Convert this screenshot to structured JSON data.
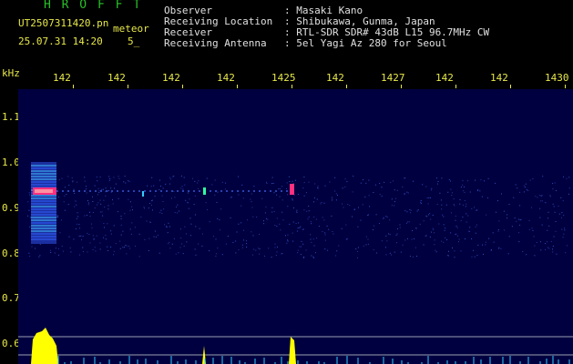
{
  "header": {
    "logo": "H R O F F T",
    "filename": "UT2507311420.pn",
    "type_label": "meteor",
    "datetime": "25.07.31 14:20",
    "count": "5_"
  },
  "info": {
    "observer_label": "Observer",
    "observer_value": ": Masaki Kano",
    "location_label": "Receiving Location",
    "location_value": ": Shibukawa, Gunma, Japan",
    "receiver_label": "Receiver",
    "receiver_value": ": RTL-SDR SDR# 43dB L15 96.7MHz CW",
    "antenna_label": "Receiving Antenna",
    "antenna_value": ": 5el Yagi Az 280 for Seoul"
  },
  "axis": {
    "y_unit": "kHz",
    "y_ticks": [
      "1.1",
      "1.0",
      "0.9",
      "0.8",
      "0.7",
      "0.6"
    ],
    "x_ticks": [
      "142",
      "142",
      "142",
      "142",
      "1425",
      "142",
      "1427",
      "142",
      "142",
      "1430"
    ]
  },
  "colors": {
    "background": "#000000",
    "plot_bg": "#000040",
    "label_yellow": "#e8e84a",
    "logo_green": "#28c228",
    "signal_yellow": "#ffff00",
    "signal_pink": "#ff3080",
    "signal_cyan": "#30d0ff"
  }
}
